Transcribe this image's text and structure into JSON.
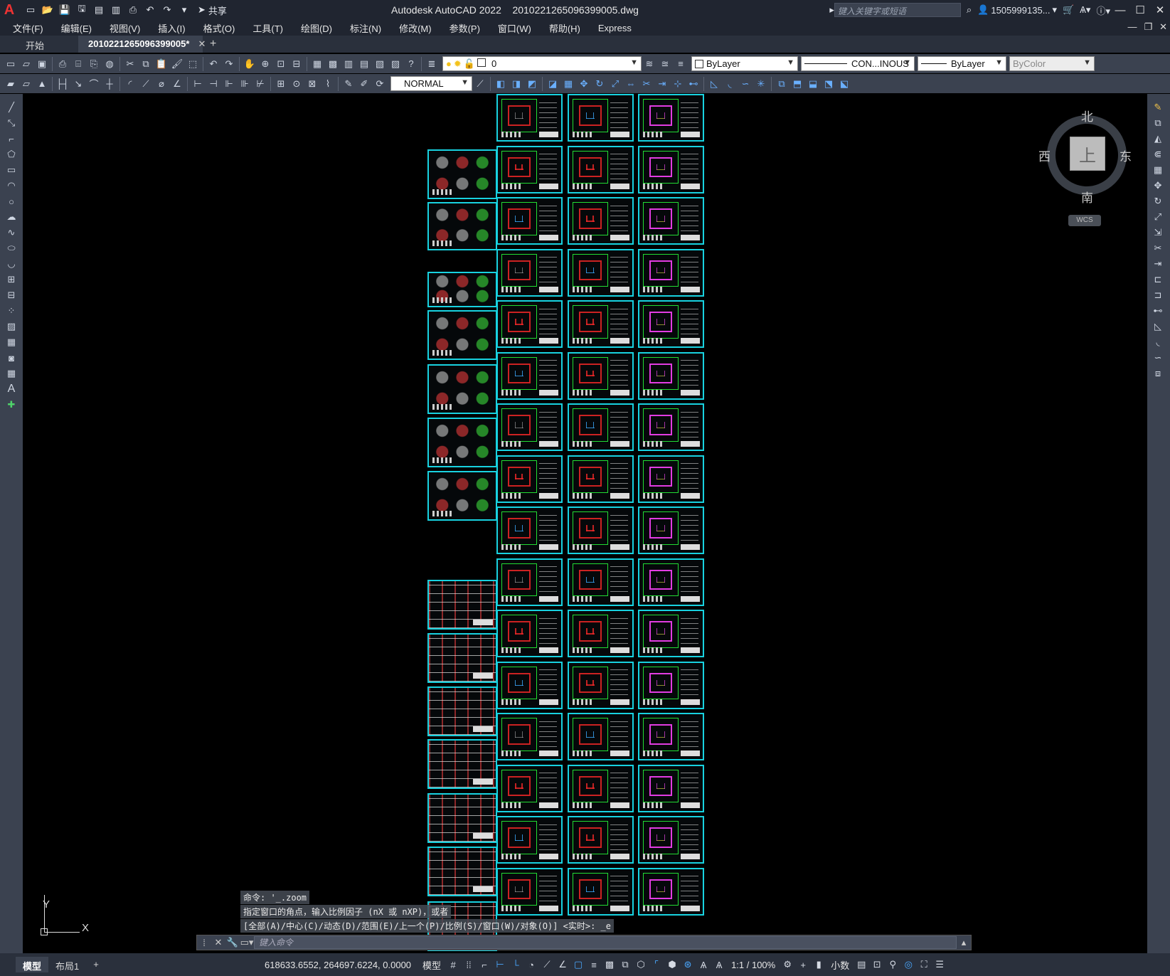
{
  "app": {
    "logo": "A",
    "title": "Autodesk AutoCAD 2022",
    "file": "2010221265096399005.dwg",
    "share_label": "共享",
    "search_placeholder": "键入关键字或短语",
    "user": "1505999135..."
  },
  "menu": [
    "文件(F)",
    "编辑(E)",
    "视图(V)",
    "插入(I)",
    "格式(O)",
    "工具(T)",
    "绘图(D)",
    "标注(N)",
    "修改(M)",
    "参数(P)",
    "窗口(W)",
    "帮助(H)",
    "Express"
  ],
  "tabs": {
    "start": "开始",
    "active": "2010221265096399005*",
    "close": "✕",
    "plus": "+"
  },
  "properties": {
    "layer": "0",
    "color": "ByLayer",
    "linetype": "CON...INOUS",
    "lineweight": "ByLayer",
    "plotstyle": "ByColor",
    "dimstyle": "NORMAL"
  },
  "viewcube": {
    "top": "上",
    "north": "北",
    "south": "南",
    "east": "东",
    "west": "西",
    "wcs": "WCS"
  },
  "ucs": {
    "x": "X",
    "y": "Y"
  },
  "command": {
    "history": [
      "命令: '_.zoom",
      "指定窗口的角点，输入比例因子 (nX 或 nXP)，或者",
      "[全部(A)/中心(C)/动态(D)/范围(E)/上一个(P)/比例(S)/窗口(W)/对象(O)] <实时>: _e"
    ],
    "placeholder": "键入命令"
  },
  "status": {
    "model_tab": "模型",
    "layout_tab": "布局1",
    "plus": "+",
    "coords": "618633.6552, 264697.6224, 0.0000",
    "space": "模型",
    "scale": "1:1 / 100%",
    "units": "小数"
  },
  "colors": {
    "sheet_border": "#18d2e0",
    "bg": "#000000",
    "ui_dark": "#202530",
    "ui_panel": "#3b4250"
  }
}
